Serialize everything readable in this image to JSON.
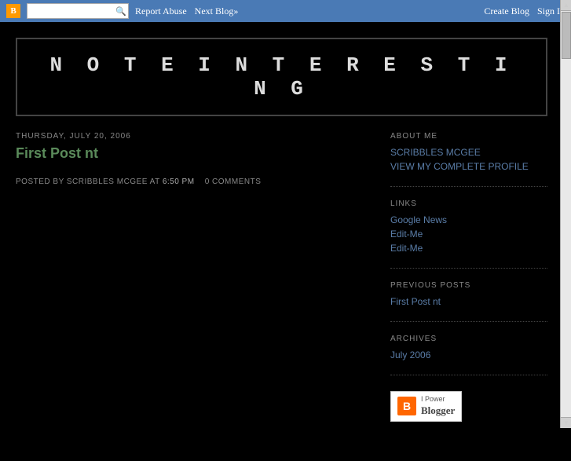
{
  "navbar": {
    "search_placeholder": "",
    "report_abuse": "Report Abuse",
    "next_blog": "Next Blog»",
    "create_blog": "Create Blog",
    "sign_in": "Sign In",
    "logo_text": "B"
  },
  "blog": {
    "title": "N O T E  I N T E R E S T I N G"
  },
  "post": {
    "date": "THURSDAY, JULY 20, 2006",
    "title": "First Post nt",
    "meta_prefix": "POSTED BY",
    "author": "SCRIBBLES MCGEE",
    "meta_at": "AT",
    "time": "6:50 PM",
    "comments": "0 COMMENTS"
  },
  "sidebar": {
    "about_title": "ABOUT ME",
    "author_name": "SCRIBBLES MCGEE",
    "view_profile": "VIEW MY COMPLETE PROFILE",
    "links_title": "LINKS",
    "links": [
      {
        "label": "Google News",
        "href": "#"
      },
      {
        "label": "Edit-Me",
        "href": "#"
      },
      {
        "label": "Edit-Me",
        "href": "#"
      }
    ],
    "prev_posts_title": "PREVIOUS POSTS",
    "prev_posts": [
      {
        "label": "First Post nt",
        "href": "#"
      }
    ],
    "archives_title": "ARCHIVES",
    "archives": [
      {
        "label": "July 2006",
        "href": "#"
      }
    ],
    "badge": {
      "powered": "I Power",
      "name": "Blogger"
    }
  }
}
